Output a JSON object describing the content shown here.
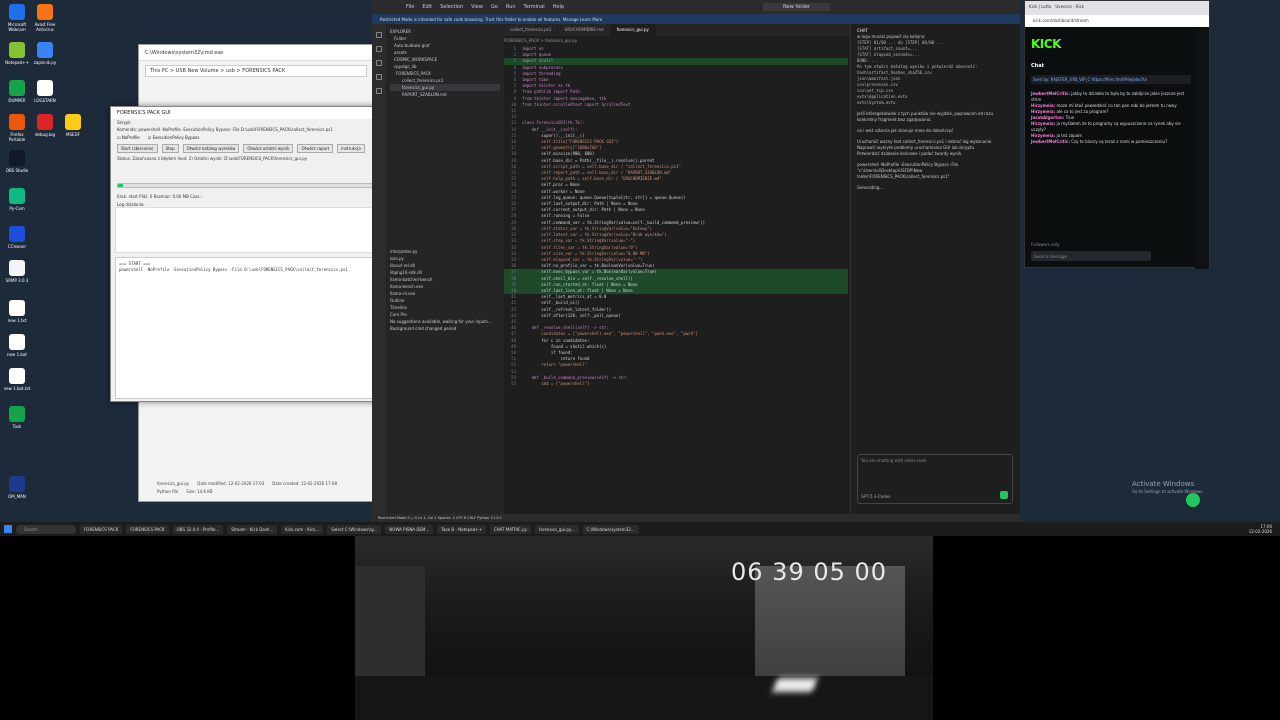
{
  "desktop": {
    "icons": [
      {
        "label": "Microsoft Webcam",
        "color": "#1f6feb"
      },
      {
        "label": "Avast Free Antivirus",
        "color": "#f97316"
      },
      {
        "label": "Notepad++",
        "color": "#86c232"
      },
      {
        "label": "zapisnik.py",
        "color": "#3b82f6"
      },
      {
        "label": "DUMPER",
        "color": "#16a34a"
      },
      {
        "label": "LOGSTARN",
        "color": "#ffffff"
      },
      {
        "label": "Firefox Portable",
        "color": "#ea580c"
      },
      {
        "label": "debug.log",
        "color": "#dc2626"
      },
      {
        "label": "MSEDF",
        "color": "#facc15"
      },
      {
        "label": "OBS Studio",
        "color": "#111827"
      },
      {
        "label": "Py-Cam",
        "color": "#10b981"
      },
      {
        "label": "CCleaner",
        "color": "#1d4ed8"
      },
      {
        "label": "SRMP 3.0.3",
        "color": "#f3f4f6"
      },
      {
        "label": "new 1.txt",
        "color": "#ffffff"
      },
      {
        "label": "new 1.bat",
        "color": "#ffffff"
      },
      {
        "label": "new 1.bat.txt",
        "color": "#ffffff"
      },
      {
        "label": "Task",
        "color": "#16a34a"
      },
      {
        "label": "OM_MAN",
        "color": "#1e3a8a"
      }
    ],
    "activate_title": "Activate Windows",
    "activate_sub": "Go to Settings to activate Windows."
  },
  "explorer": {
    "title": "C:\\Windows\\system32\\cmd.exe",
    "address": "This PC > USB New Volume > usb > FORENSICS PACK",
    "file_name": "forensics_gui.py",
    "file_modified": "Date modified: 12-02-2026 17:03",
    "file_created": "Date created: 12-02-2026 17:08",
    "file_type": "Python file",
    "file_size": "Size: 14.6 KB"
  },
  "gui": {
    "title": "FORENSICS PACK GUI",
    "script_label": "Skrypt:",
    "command_label": "Komenda:",
    "command_value": "powershell -NoProfile -ExecutionPolicy Bypass -File D:\\usb\\FORENSICS_PACK\\collect_forensics.ps1",
    "chk_noprofile": "NoProfile",
    "chk_bypass": "ExecutionPolicy Bypass",
    "btn_start": "Start (zbieranie)",
    "btn_stop": "Stop",
    "btn_open_out": "Otwórz katalog wyników",
    "btn_open_report": "Otwórz ostatni wynik",
    "btn_open_raport": "Otwórz raport",
    "btn_help": "Instrukcja",
    "status_line": "Status:  Zakończono z błędem (kod: 2)   Ostatni wynik: D:\\usb\\FORENSICS_PACK\\forensics_gui.py",
    "progress_fraction": 0.012,
    "stats_line": "Krok: start   Pliki: 0   Rozmiar: 0.00 MB   Czas: -",
    "clear_btn": "Wyczyść zapis",
    "log_label": "Log działania:",
    "log_lines": [
      "=== START ===",
      "powershell -NoProfile -ExecutionPolicy Bypass -File D:\\usb\\FORENSICS_PACK\\collect_forensics.ps1"
    ]
  },
  "vscode": {
    "menu": [
      "File",
      "Edit",
      "Selection",
      "View",
      "Go",
      "Run",
      "Terminal",
      "Help"
    ],
    "search_placeholder": "New folder",
    "notice": "Restricted Mode is intended for safe code browsing. Trust this folder to enable all features.  Manage   Learn More",
    "explorer_title": "Explorer",
    "tree": [
      "Folder",
      "Auto budowa graf",
      "assets",
      "COSMIC_WORKSPACE",
      "cpyalgo_lib",
      "FORENSICS_PACK",
      "collect_forensics.ps1",
      "forensics_gui.py",
      "RAPORT_SZABLON.md"
    ],
    "tree_lower": [
      "interpreter.py",
      "loss.py",
      "libcurl-rel.dll",
      "libpng16-sdk.dll",
      "llama-batched-bench",
      "llama-bench.exe",
      "llama-cli.exe",
      "Outline",
      "Timeline",
      "Core Pro",
      "No suggestions available, waiting for your inputs...",
      "Background cmd changed period"
    ],
    "tabs": [
      "collect_forensics.ps1",
      "URUCHOMIENIE.md",
      "forensics_gui.py"
    ],
    "crumbs": "FORENSICS_PACK > forensics_gui.py",
    "code_lines": [
      "import os",
      "import queue",
      "import shutil",
      "import subprocess",
      "import threading",
      "import time",
      "import tkinter as tk",
      "from pathlib import Path",
      "from tkinter import messagebox, ttk",
      "from tkinter.scrolledtext import ScrolledText",
      "",
      "",
      "class ForensicsGUI(tk.Tk):",
      "    def __init__(self):",
      "        super().__init__()",
      "        self.title(\"FORENSICS PACK GUI\")",
      "        self.geometry(\"1080x760\")",
      "        self.minsize(900, 600)",
      "        self.base_dir = Path(__file__).resolve().parent",
      "        self.script_path = self.base_dir / \"collect_forensics.ps1\"",
      "        self.report_path = self.base_dir / \"RAPORT_SZABLON.md\"",
      "        self.help_path = self.base_dir / \"URUCHOMIENIE.md\"",
      "        self.proc = None",
      "        self.worker = None",
      "        self.log_queue: queue.Queue[tuple[str, str]] = queue.Queue()",
      "        self.last_output_dir: Path | None = None",
      "        self.current_output_dir: Path | None = None",
      "        self.running = False",
      "        self.command_var = tk.StringVar(value=self._build_command_preview())",
      "        self.status_var = tk.StringVar(value=\"Gotowy\")",
      "        self.latest_var = tk.StringVar(value=\"Brak wyników\")",
      "        self.step_var = tk.StringVar(value=\"-\")",
      "        self.files_var = tk.StringVar(value=\"0\")",
      "        self.size_var = tk.StringVar(value=\"0.00 MB\")",
      "        self.elapsed_var = tk.StringVar(value=\"-\")",
      "        self.no_profile_var = tk.BooleanVar(value=True)",
      "        self.exec_bypass_var = tk.BooleanVar(value=True)",
      "        self.shell_bin = self._resolve_shell()",
      "        self.run_started_at: float | None = None",
      "        self.last_line_at: float | None = None",
      "        self._last_metrics_at = 0.0",
      "        self._build_ui()",
      "        self._refresh_latest_folder()",
      "        self.after(120, self._poll_queue)",
      "",
      "    def _resolve_shell(self) -> str:",
      "        candidates = [\"powershell.exe\", \"powershell\", \"pwsh.exe\", \"pwsh\"]",
      "        for c in candidates:",
      "            found = shutil.which(c)",
      "            if found:",
      "                return found",
      "        return \"powershell\"",
      "",
      "    def _build_command_preview(self) -> str:",
      "        cmd = [\"powershell\"]"
    ],
    "chat_title": "CHAT",
    "chat_lines": [
      "w logu musisz pojawić się kolejno:",
      "[STEP] 01/08 ... do [STEP] 08/08 ...",
      "[STAT] artifact_count=...",
      "[STAT] elapsed_seconds=...",
      "DONE: ...",
      "Po tym otwórz katalog wyniku i potwierdź obecność:",
      "hash\\artifact_hashes_sha256.csv",
      "json\\manifest.json",
      "csv\\processes.csv",
      "csv\\net_tcp.csv",
      "evtx\\Application.evtx",
      "evtx\\System.evtx",
      "Jeśli któregokolwiek z tych punktów nie wyjdzie, poprawiam od razu konkretny fragment bez zgadywania.",
      "no i weź szkenia jak skanuje mnie do dokończyć",
      "Uruchomić ważny test collect_forensics.ps1 i zebrać log wykonania",
      "Naprawić wykryte problemy uruchamiania GUI lub skryptu",
      "Potwierdzić działanie końcowe i podać twardy wynik",
      "powershell -NoProfile -ExecutionPolicy Bypass -File \"c:\\Users\\ol\\Desktop\\USFDP\\New folder\\FORENSICS_PACK\\collect_forensics.ps1\"",
      "Generating...",
      "You are chatting with notes code",
      "GPT-5.3-Codex"
    ],
    "status_bar": "Restricted Mode   0 △ 0   Ln 1, Col 1   Spaces: 4   UTF-8   CRLF   Python   3.13.0"
  },
  "browser": {
    "tab1": "Kick | Lotto",
    "tab2": "Uvecera - Kick",
    "url": "kick.com/dashboard/stream",
    "logo": "KICK",
    "chat_header": "Chat",
    "pinned": "Sent by: RAJSTER_SYB_VIP_C   https://files.fm/f/h9ybdw7tv",
    "messages": [
      {
        "user": "JewbertMelCritic:",
        "text": "jakby to działało to było by to zabójcze jakie jeszcze jest strim"
      },
      {
        "user": "Hirzymeia:",
        "text": "może mi ktoś powiedzieć co tan pan robi bo jestem tu nowy"
      },
      {
        "user": "Hirzymeia:",
        "text": "ale co to jest za program?"
      },
      {
        "user": "JacobAlgorton:",
        "text": "True"
      },
      {
        "user": "Hirzymeia:",
        "text": "ja myślałem że to programy są wypuszczone na rynek aby sie uczyły?"
      },
      {
        "user": "Hirzymeia:",
        "text": "ja też zapale"
      },
      {
        "user": "JewbertMelCritic:",
        "text": "Czy te binary są teraz z nami w pomieszczeniu?"
      }
    ],
    "followers": "Followers only",
    "send_placeholder": "Send a message"
  },
  "taskbar": {
    "search": "Search",
    "apps": [
      "FORENSICS PACK",
      "FORENSICS PACK",
      "OBS 32.0.4 - Profile...",
      "Stream - Kick Dash...",
      "Kick.com - Kick...",
      "Select C:\\Windows\\sy...",
      "NOWA PISNA DEM...",
      "Taxe B - Notepad++",
      "CHAT MATRIC.py",
      "forensics_gui.py...",
      "C:\\Windows\\system32..."
    ],
    "time": "17:06",
    "date": "12-02-2026"
  },
  "webcam": {
    "timestamp": "06 39 05 00"
  }
}
